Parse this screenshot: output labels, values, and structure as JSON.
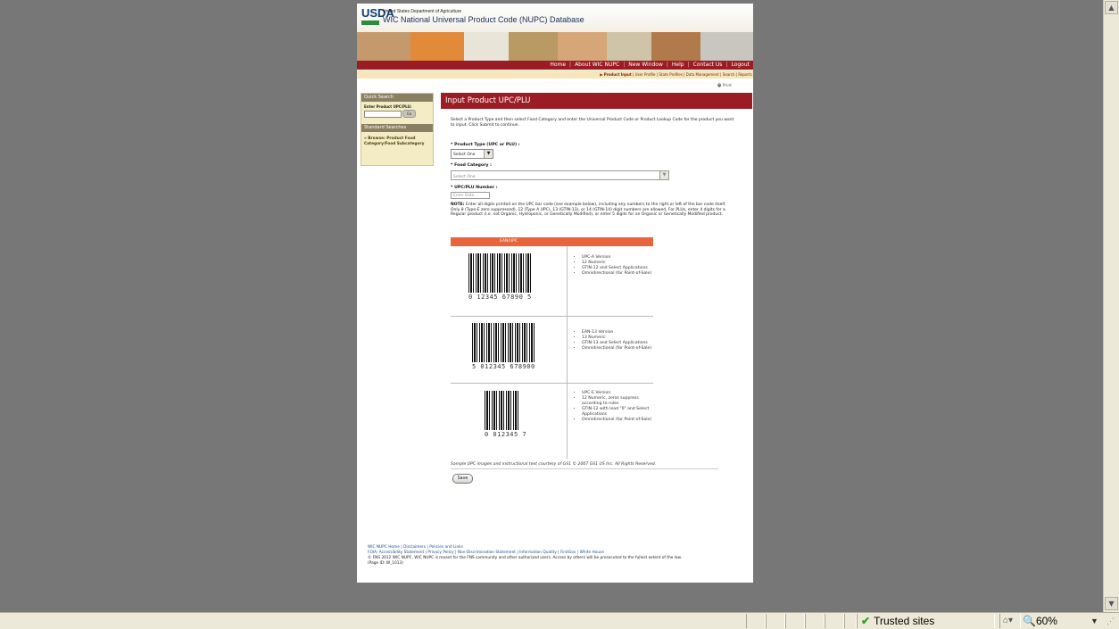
{
  "header": {
    "logo": "USDA",
    "agency": "United States Department of Agriculture",
    "title": "WIC National Universal Product Code (NUPC) Database"
  },
  "nav": {
    "items": [
      "Home",
      "About WIC NUPC",
      "New Window",
      "Help",
      "Contact Us",
      "Logout"
    ]
  },
  "subnav": {
    "active": "Product Input",
    "items": [
      "User Profile",
      "State Profiles",
      "Data Management",
      "Search",
      "Reports"
    ]
  },
  "print_label": "Print",
  "sidebar": {
    "quick_search": "Quick Search",
    "upc_label": "Enter Product UPC/PLU:",
    "go": "Go",
    "standard_searches": "Standard Searches",
    "browse": "Browse: Product Food Category/Food Subcategory"
  },
  "main": {
    "title": "Input Product UPC/PLU",
    "intro": "Select a Product Type and then select Food Category and enter the Universal Product Code or Product Lookup Code for the product you want to input. Click Submit to continue.",
    "product_type_label": "* Product Type (UPC or PLU) :",
    "product_type_value": "Select One",
    "food_category_label": "* Food Category :",
    "food_category_value": "Select One",
    "upc_label": "* UPC/PLU Number :",
    "upc_placeholder": "Enter Data",
    "note_label": "NOTE:",
    "note": "Enter all digits printed on the UPC bar code (see example below), including any numbers to the right or left of the bar code itself. Only 8 (Type-E zero suppressed), 12 (Type A UPC), 13 (GTIN-13), or 14 (GTIN-14) digit numbers are allowed. For PLUs, enter 4 digits for a Regular product (i.e. not Organic, Hydroponic, or Genetically Modified), or enter 5 digits for an Organic or Genetically Modified product.",
    "table_header": "EAN/UPC",
    "barcodes": [
      {
        "digits": "0  12345 67890  5",
        "bullets": [
          "UPC-A Version",
          "12 Numeric",
          "GTIN-12 and Select Applications",
          "Omnidirectional (for Point-of-Sale)"
        ]
      },
      {
        "digits": "5 012345 678900",
        "bullets": [
          "EAN-13 Version",
          "13 Numeric",
          "GTIN-13 and Select Applications",
          "Omnidirectional (for Point-of-Sale)"
        ]
      },
      {
        "digits": "0  012345  7",
        "bullets": [
          "UPC-E Version",
          "12 Numeric, zeros suppress according to rules",
          "GTIN-12 with lead \"0\" and Select Applications",
          "Omnidirectional (for Point-of-Sale)"
        ]
      }
    ],
    "caption": "Sample UPC images and instructional text courtesy of GS1 © 2007 GS1 US Inc. All Rights Reserved.",
    "save": "Save"
  },
  "footer": {
    "line1": "WIC NUPC Home | Disclaimers | Policies and Links",
    "line2": "FOIA: Accessibility Statement | Privacy Policy | Non-Discrimination Statement | Information Quality | FirstGov | White House",
    "line3": "© FNS 2012 WIC NUPC. WIC NUPC is meant for the FNS community and other authorized users. Access by others will be prosecuted to the fullest extent of the law.",
    "line4": "(Page ID: W_1013)"
  },
  "statusbar": {
    "zone": "Trusted sites",
    "zoom": "60%"
  }
}
